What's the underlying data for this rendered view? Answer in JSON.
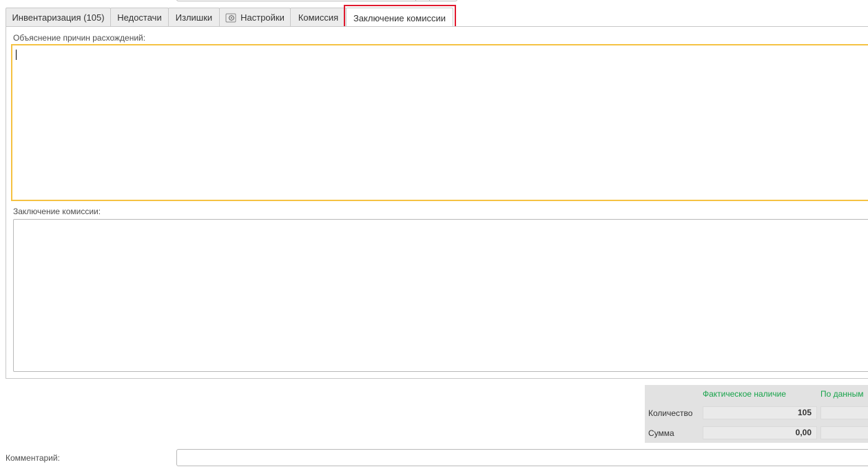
{
  "tabs": [
    {
      "label": "Инвентаризация (105)"
    },
    {
      "label": "Недостачи"
    },
    {
      "label": "Излишки"
    },
    {
      "label": "Настройки",
      "icon": "gear-icon"
    },
    {
      "label": "Комиссия"
    },
    {
      "label": "Заключение комиссии",
      "active": true
    }
  ],
  "form": {
    "explanation_label": "Объяснение причин расхождений:",
    "explanation_value": "",
    "conclusion_label": "Заключение комиссии:",
    "conclusion_value": ""
  },
  "totals": {
    "col_actual": "Фактическое наличие",
    "col_records": "По данным",
    "row_quantity_label": "Количество",
    "row_quantity_actual": "105",
    "row_quantity_records": "",
    "row_sum_label": "Сумма",
    "row_sum_actual": "0,00",
    "row_sum_records": ""
  },
  "comment": {
    "label": "Комментарий:",
    "value": ""
  },
  "colors": {
    "active_field_border": "#f5c242",
    "highlight_border": "#e0192e",
    "totals_header": "#17a34a"
  }
}
